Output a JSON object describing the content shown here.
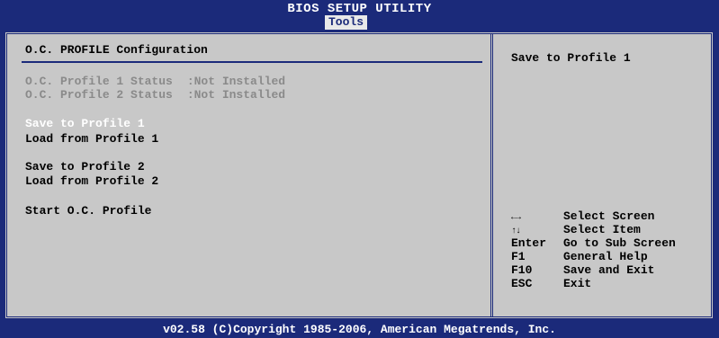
{
  "header": {
    "title": "BIOS SETUP UTILITY",
    "active_tab": "Tools"
  },
  "main": {
    "section_title": "O.C. PROFILE Configuration",
    "status": [
      {
        "label": "O.C. Profile 1 Status",
        "value": ":Not Installed"
      },
      {
        "label": "O.C. Profile 2 Status",
        "value": ":Not Installed"
      }
    ],
    "items": [
      "Save to Profile 1",
      "Load from Profile 1",
      "Save to Profile 2",
      "Load from Profile 2",
      "Start O.C. Profile"
    ]
  },
  "help": {
    "text": "Save to Profile 1",
    "keys": [
      {
        "key": "←→",
        "icon": "left-right-arrows-icon",
        "desc": "Select Screen"
      },
      {
        "key": "↑↓",
        "icon": "up-down-arrows-icon",
        "desc": "Select Item"
      },
      {
        "key": "Enter",
        "desc": "Go to Sub Screen"
      },
      {
        "key": "F1",
        "desc": "General Help"
      },
      {
        "key": "F10",
        "desc": "Save and Exit"
      },
      {
        "key": "ESC",
        "desc": "Exit"
      }
    ]
  },
  "footer": {
    "copyright": "v02.58 (C)Copyright 1985-2006, American Megatrends, Inc."
  },
  "colors": {
    "background": "#1b2a7a",
    "panel": "#c8c8c8",
    "highlight": "#ffffff",
    "disabled": "#8a8a8a"
  }
}
